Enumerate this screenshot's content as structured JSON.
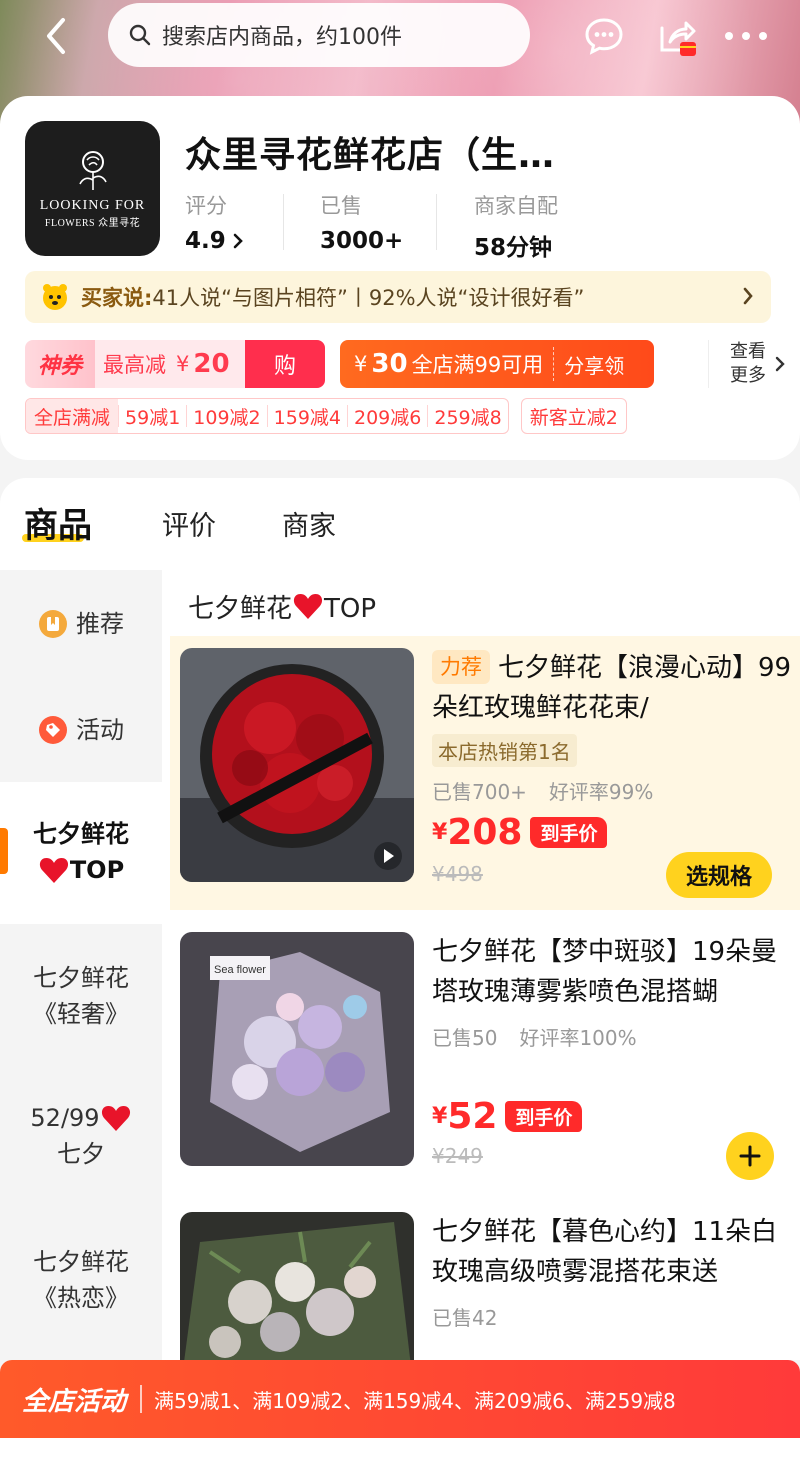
{
  "search": {
    "placeholder": "搜索店内商品，约100件"
  },
  "shop": {
    "name": "众里寻花鲜花店（生…",
    "logo_line1": "LOOKING FOR",
    "logo_line2": "FLOWERS 众里寻花",
    "stats": [
      {
        "label": "评分",
        "value": "4.9"
      },
      {
        "label": "已售",
        "value": "3000+"
      },
      {
        "label": "商家自配",
        "value": "58分钟"
      }
    ]
  },
  "buyer_say": {
    "title": "买家说:",
    "text": "41人说“与图片相符”丨92%人说“设计很好看”"
  },
  "coupons": {
    "c1_tag": "神券",
    "c1_text": "最高减",
    "c1_yen": "¥",
    "c1_amount": "20",
    "c1_action": "购",
    "c2_yen": "¥",
    "c2_amount": "30",
    "c2_text": "全店满99可用",
    "c2_action": "分享领",
    "see_more_1": "查看",
    "see_more_2": "更多"
  },
  "promo": {
    "lead": "全店满减",
    "items": [
      "59减1",
      "109减2",
      "159减4",
      "209减6",
      "259减8"
    ],
    "new_customer": "新客立减2"
  },
  "tabs": [
    "商品",
    "评价",
    "商家"
  ],
  "categories": {
    "recommend": "推荐",
    "activity": "活动",
    "qixi_top_1": "七夕鲜花",
    "qixi_top_2": "TOP",
    "luxury_1": "七夕鲜花",
    "luxury_2": "《轻奢》",
    "deal_1": "52/99",
    "deal_2": "七夕",
    "passion_1": "七夕鲜花",
    "passion_2": "《热恋》"
  },
  "section_title": {
    "pre": "七夕鲜花",
    "post": "TOP"
  },
  "products": [
    {
      "badge": "力荐",
      "title": "七夕鲜花【浪漫心动】99朵红玫瑰鲜花花束/",
      "hot": "本店热销第1名",
      "sold": "已售700+",
      "rating": "好评率99%",
      "yen": "¥",
      "price": "208",
      "price_tag": "到手价",
      "old_price": "¥498",
      "button": "选规格"
    },
    {
      "title": "七夕鲜花【梦中斑驳】19朵曼塔玫瑰薄雾紫喷色混搭蝴",
      "sold": "已售50",
      "rating": "好评率100%",
      "yen": "¥",
      "price": "52",
      "price_tag": "到手价",
      "old_price": "¥249",
      "image_text": "Sea flower"
    },
    {
      "title": "七夕鲜花【暮色心约】11朵白玫瑰高级喷雾混搭花束送",
      "sold": "已售42"
    }
  ],
  "bottom_banner": {
    "title": "全店活动",
    "text": "满59减1、满109减2、满159减4、满209减6、满259减8"
  },
  "colors": {
    "accent_yellow": "#ffd21e",
    "price_red": "#ff2a2a",
    "orange": "#ff6a1f"
  }
}
